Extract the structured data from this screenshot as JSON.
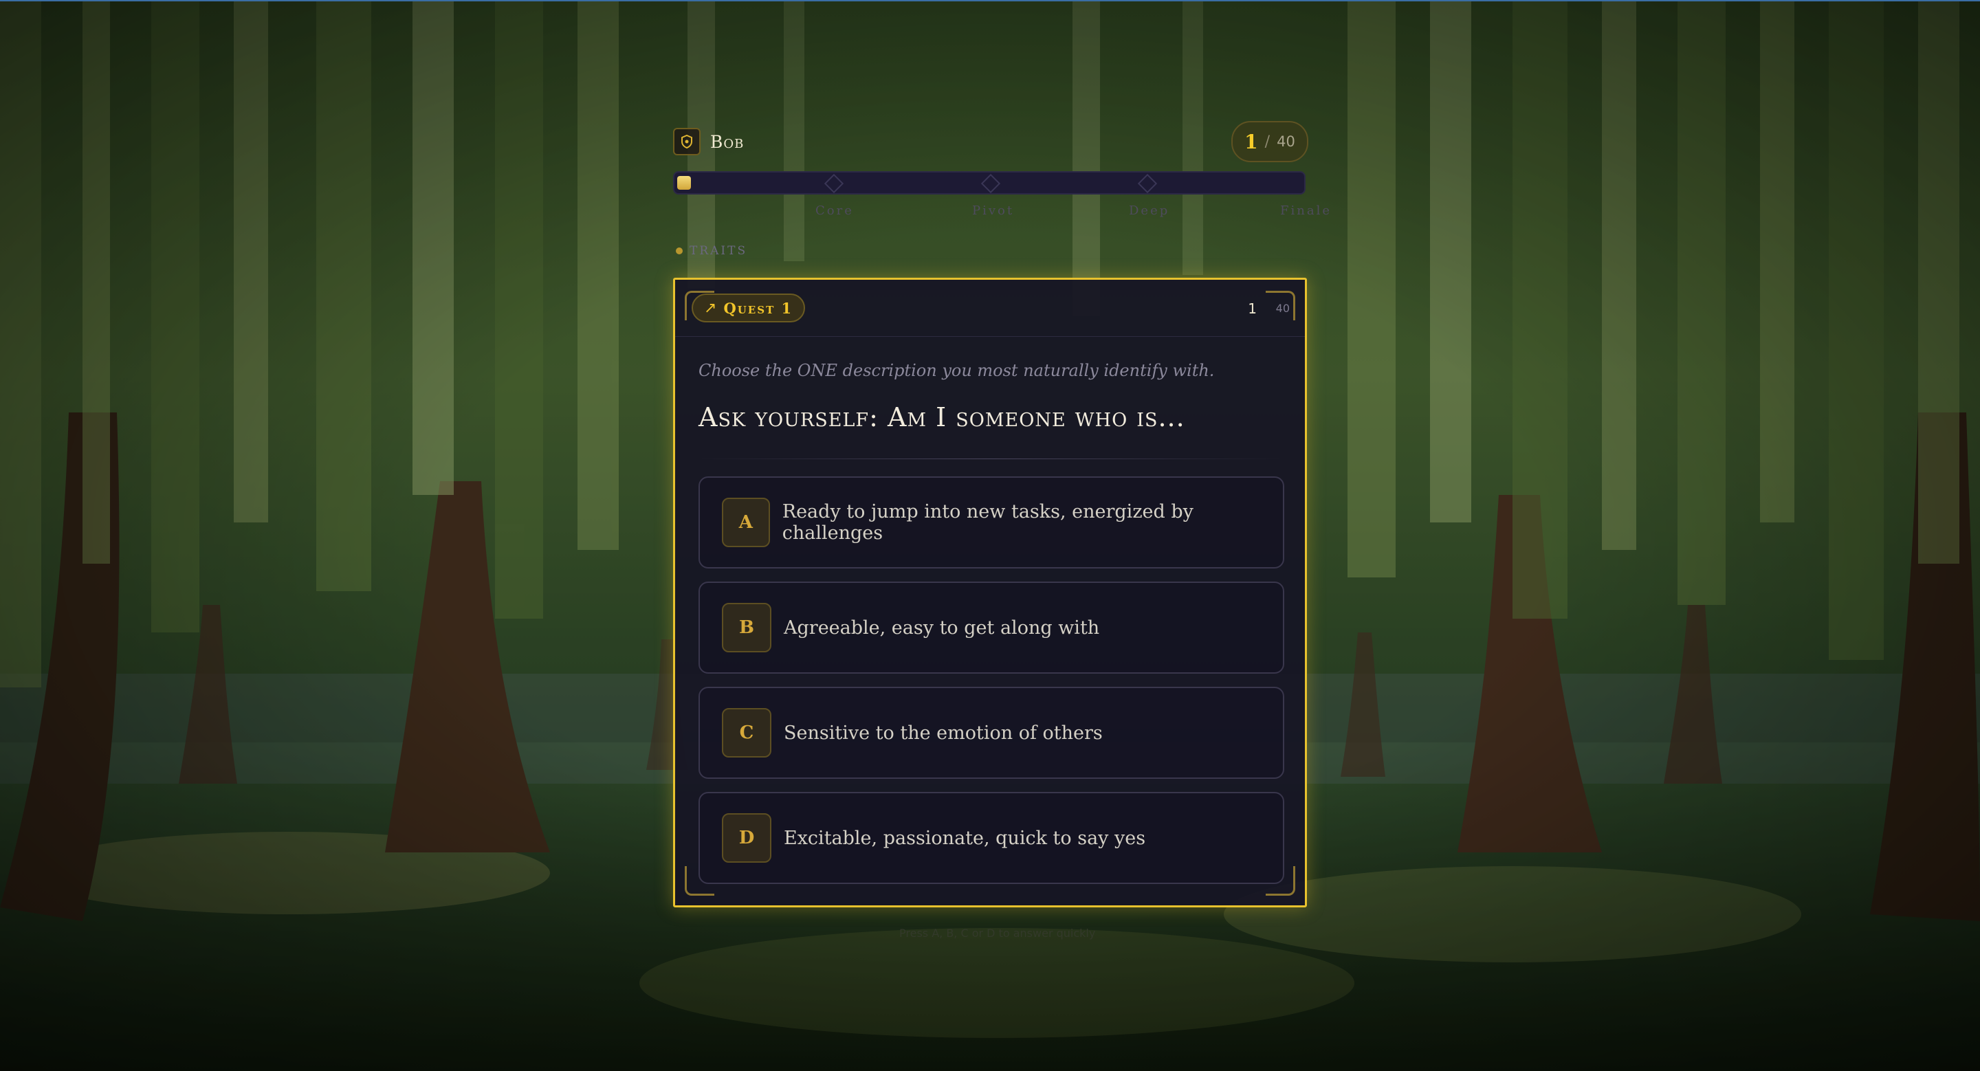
{
  "player": {
    "name": "Bob",
    "icon": "shield-icon"
  },
  "counter": {
    "current": "1",
    "separator": "/",
    "total": "40"
  },
  "progress": {
    "fraction": 0.02,
    "milestones": [
      "Core",
      "Pivot",
      "Deep",
      "Finale"
    ]
  },
  "section": {
    "label": "TRAITS"
  },
  "quest": {
    "badge_icon": "arrow-up-right-icon",
    "badge_label": "Quest 1",
    "number": "1",
    "total": "40",
    "instruction": "Choose the ONE description you most naturally identify with.",
    "question": "Ask yourself: Am I someone who is...",
    "options": [
      {
        "letter": "A",
        "text": "Ready to jump into new tasks, energized by challenges"
      },
      {
        "letter": "B",
        "text": "Agreeable, easy to get along with"
      },
      {
        "letter": "C",
        "text": "Sensitive to the emotion of others"
      },
      {
        "letter": "D",
        "text": "Excitable, passionate, quick to say yes"
      }
    ]
  },
  "hint": "Press A, B, C or D to answer quickly",
  "colors": {
    "accent": "#e8c22e",
    "card": "#161524",
    "text": "#f2ecdd"
  }
}
